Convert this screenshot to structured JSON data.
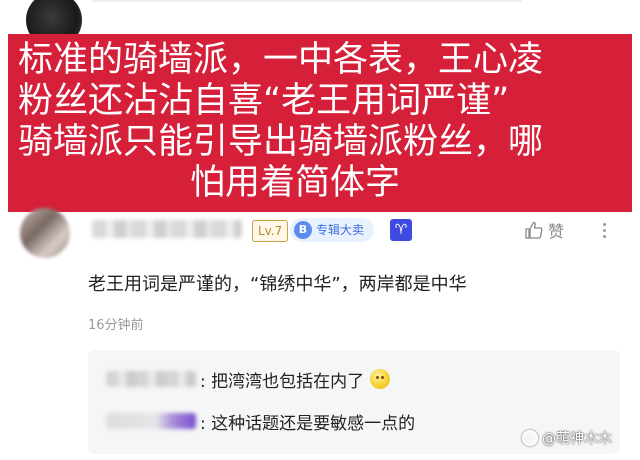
{
  "banner": {
    "lines": [
      "标准的骑墙派，一中各表，王心凌",
      "粉丝还沾沾自喜“老王用词严谨”",
      "骑墙派只能引导出骑墙派粉丝，哪",
      "怕用着简体字"
    ],
    "color": "#d61f39"
  },
  "comment": {
    "level_badge": "Lv.7",
    "editor_badge_icon": "B",
    "editor_badge": "专辑大卖",
    "zodiac_badge": "♈",
    "like_label": "赞",
    "text": "老王用词是严谨的，“锦绣中华”，两岸都是中华",
    "time": "16分钟前"
  },
  "replies": [
    {
      "text": ": 把湾湾也包括在内了",
      "emoji": "smile-emoji"
    },
    {
      "text": ": 这种话题还是要敏感一点的"
    }
  ],
  "watermark": "@萌神木木"
}
